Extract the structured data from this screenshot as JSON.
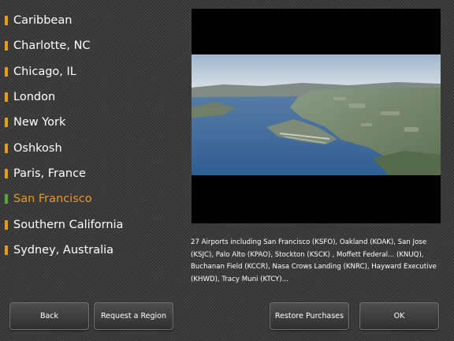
{
  "regions": [
    {
      "label": "Caribbean"
    },
    {
      "label": "Charlotte, NC"
    },
    {
      "label": "Chicago, IL"
    },
    {
      "label": "London"
    },
    {
      "label": "New York"
    },
    {
      "label": "Oshkosh"
    },
    {
      "label": "Paris, France"
    },
    {
      "label": "San Francisco"
    },
    {
      "label": "Southern California"
    },
    {
      "label": "Sydney, Australia"
    }
  ],
  "selected_region": "San Francisco",
  "description": "27 Airports including San Francisco (KSFO), Oakland (KOAK), San Jose (KSJC), Palo Alto (KPAO), Stockton (KSCK) , Moffett Federal... (KNUQ), Buchanan Field (KCCR), Nasa Crows Landing (KNRC), Hayward Executive (KHWD), Tracy Muni (KTCY)...",
  "buttons": {
    "back": "Back",
    "request": "Request a Region",
    "restore": "Restore Purchases",
    "ok": "OK"
  },
  "colors": {
    "accent_orange": "#e8962a",
    "selected_marker": "#55aa33"
  }
}
